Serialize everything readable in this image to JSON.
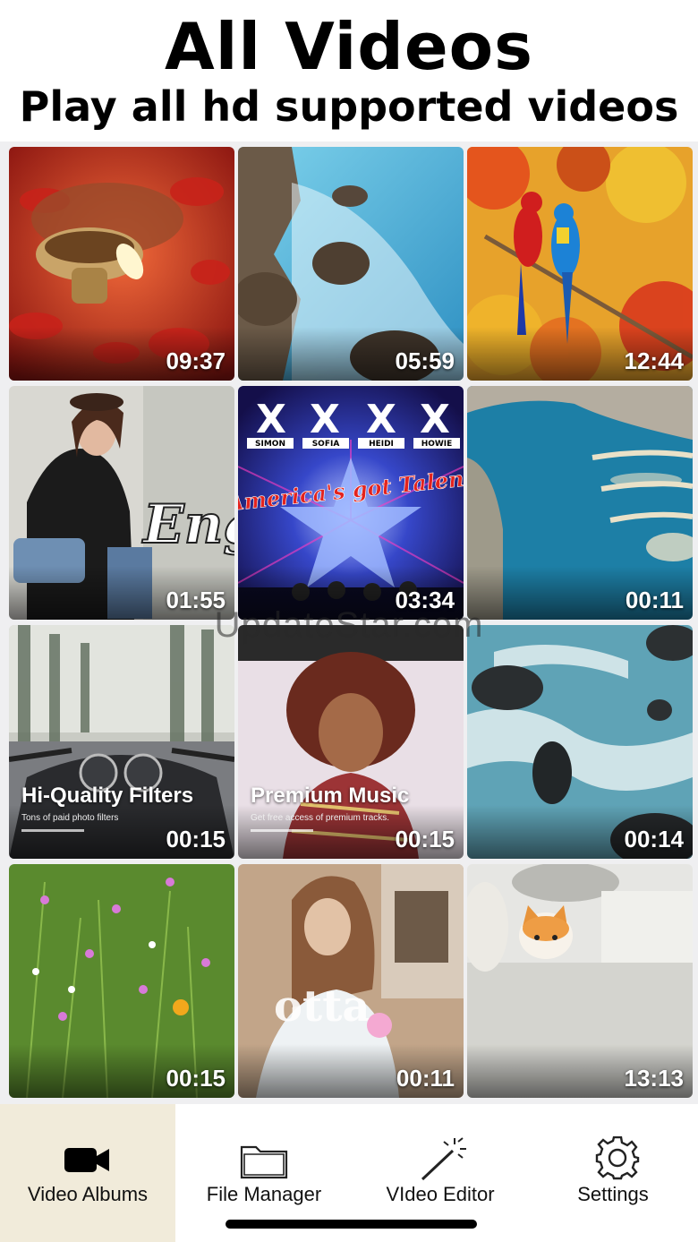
{
  "header": {
    "title": "All Videos",
    "subtitle": "Play all hd supported videos"
  },
  "videos": [
    {
      "duration": "09:37",
      "thumb": "diya-lamp-petals"
    },
    {
      "duration": "05:59",
      "thumb": "ocean-rocks"
    },
    {
      "duration": "12:44",
      "thumb": "parrots-autumn"
    },
    {
      "duration": "01:55",
      "thumb": "woman-portrait",
      "caption": "Eng"
    },
    {
      "duration": "03:34",
      "thumb": "talent-show-stage",
      "labels": [
        "SIMON",
        "SOFIA",
        "HEIDI",
        "HOWIE"
      ],
      "logo": "America's got Talent"
    },
    {
      "duration": "00:11",
      "thumb": "palm-island-aerial"
    },
    {
      "duration": "00:15",
      "thumb": "motorbike-road",
      "overlay_title": "Hi-Quality Filters",
      "overlay_sub": "Tons of paid photo filters"
    },
    {
      "duration": "00:15",
      "thumb": "curly-hair-woman",
      "overlay_title": "Premium Music",
      "overlay_sub": "Get free access of premium tracks."
    },
    {
      "duration": "00:14",
      "thumb": "river-rocks"
    },
    {
      "duration": "00:15",
      "thumb": "wildflowers"
    },
    {
      "duration": "00:11",
      "thumb": "girl-selfie",
      "caption": "otta"
    },
    {
      "duration": "13:13",
      "thumb": "kitten-sofa"
    }
  ],
  "watermark": "UpdateStar.com",
  "tabs": [
    {
      "label": "Video Albums",
      "icon": "video-camera-icon",
      "active": true
    },
    {
      "label": "File Manager",
      "icon": "folder-icon",
      "active": false
    },
    {
      "label": "VIdeo Editor",
      "icon": "magic-wand-icon",
      "active": false
    },
    {
      "label": "Settings",
      "icon": "gear-icon",
      "active": false
    }
  ],
  "colors": {
    "active_tab_bg": "#f1ebda",
    "grid_bg": "#efeff1"
  }
}
